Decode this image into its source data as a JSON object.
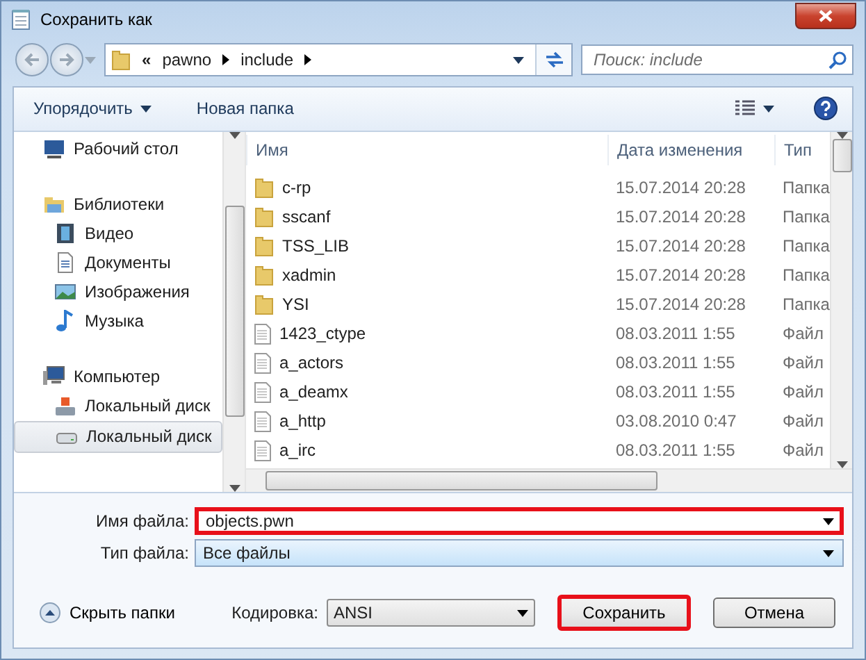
{
  "window": {
    "title": "Сохранить как"
  },
  "address": {
    "overflow": "«",
    "crumbs": [
      "pawno",
      "include"
    ]
  },
  "search": {
    "placeholder": "Поиск: include"
  },
  "toolbar": {
    "organize": "Упорядочить",
    "new_folder": "Новая папка"
  },
  "sidebar": {
    "items": [
      {
        "kind": "desktop",
        "label": "Рабочий стол",
        "selected": false
      },
      {
        "kind": "library",
        "label": "Библиотеки",
        "selected": false,
        "children": [
          {
            "kind": "video",
            "label": "Видео",
            "selected": false
          },
          {
            "kind": "docs",
            "label": "Документы",
            "selected": false
          },
          {
            "kind": "images",
            "label": "Изображения",
            "selected": false
          },
          {
            "kind": "music",
            "label": "Музыка",
            "selected": false
          }
        ]
      },
      {
        "kind": "computer",
        "label": "Компьютер",
        "selected": false,
        "children": [
          {
            "kind": "sysdisk",
            "label": "Локальный диск",
            "selected": false
          },
          {
            "kind": "disk",
            "label": "Локальный диск",
            "selected": true
          }
        ]
      }
    ]
  },
  "table": {
    "columns": [
      "Имя",
      "Дата изменения",
      "Тип"
    ],
    "rows": [
      {
        "kind": "folder",
        "name": "c-rp",
        "date": "15.07.2014 20:28",
        "type": "Папка"
      },
      {
        "kind": "folder",
        "name": "sscanf",
        "date": "15.07.2014 20:28",
        "type": "Папка"
      },
      {
        "kind": "folder",
        "name": "TSS_LIB",
        "date": "15.07.2014 20:28",
        "type": "Папка"
      },
      {
        "kind": "folder",
        "name": "xadmin",
        "date": "15.07.2014 20:28",
        "type": "Папка"
      },
      {
        "kind": "folder",
        "name": "YSI",
        "date": "15.07.2014 20:28",
        "type": "Папка"
      },
      {
        "kind": "file",
        "name": "1423_ctype",
        "date": "08.03.2011 1:55",
        "type": "Файл"
      },
      {
        "kind": "file",
        "name": "a_actors",
        "date": "08.03.2011 1:55",
        "type": "Файл"
      },
      {
        "kind": "file",
        "name": "a_deamx",
        "date": "08.03.2011 1:55",
        "type": "Файл"
      },
      {
        "kind": "file",
        "name": "a_http",
        "date": "03.08.2010 0:47",
        "type": "Файл"
      },
      {
        "kind": "file",
        "name": "a_irc",
        "date": "08.03.2011 1:55",
        "type": "Файл"
      }
    ]
  },
  "form": {
    "filename_label": "Имя файла:",
    "filename": "objects.pwn",
    "filename_highlighted": true,
    "filetype_label": "Тип файла:",
    "filetype": "Все файлы"
  },
  "footer": {
    "hide_folders": "Скрыть папки",
    "encoding_label": "Кодировка:",
    "encoding": "ANSI",
    "buttons": [
      {
        "label": "Сохранить",
        "highlighted": true
      },
      {
        "label": "Отмена",
        "highlighted": false
      }
    ]
  }
}
